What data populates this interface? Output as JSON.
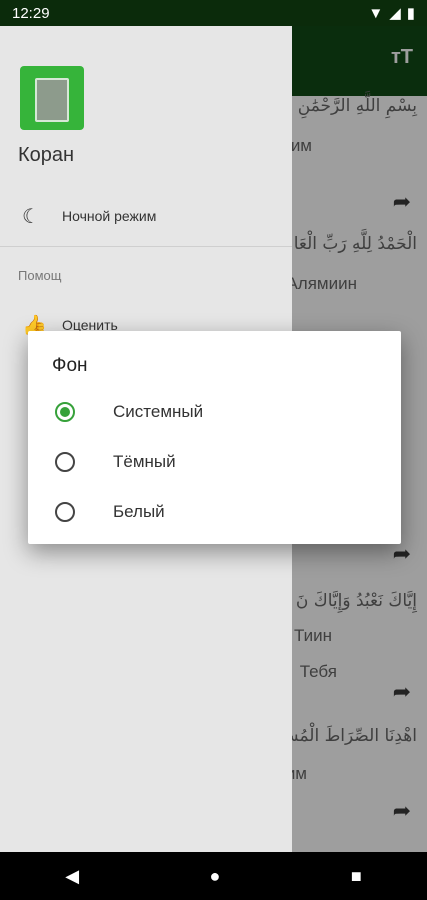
{
  "status_bar": {
    "time": "12:29"
  },
  "content": {
    "lines": [
      {
        "text": "بِسْمِ اللَّهِ الرَّحْمَٰنِ",
        "arabic": true
      },
      {
        "text": "им",
        "arabic": false
      },
      {
        "text": "الْحَمْدُ لِلَّهِ رَبِّ الْعَا",
        "arabic": true
      },
      {
        "text": "Алямиин",
        "arabic": false
      },
      {
        "text": "إِيَّاكَ نَعْبُدُ وَإِيَّاكَ نَ",
        "arabic": true
      },
      {
        "text": "Тиин",
        "arabic": false
      },
      {
        "text": "Тебя",
        "arabic": false
      },
      {
        "text": "اهْدِنَا الصِّرَاطَ الْمُسْ",
        "arabic": true
      },
      {
        "text": "им",
        "arabic": false
      }
    ]
  },
  "drawer": {
    "app_name": "Коран",
    "items": [
      {
        "label": "Ночной режим",
        "icon": "moon-icon"
      },
      {
        "label": "Оценить",
        "icon": "thumb-up-icon"
      }
    ],
    "section_label": "Помощ"
  },
  "dialog": {
    "title": "Фон",
    "options": [
      {
        "label": "Системный",
        "selected": true
      },
      {
        "label": "Тёмный",
        "selected": false
      },
      {
        "label": "Белый",
        "selected": false
      }
    ]
  },
  "colors": {
    "app_bar": "#114a15",
    "accent": "#36a13a",
    "status_bar": "#0b2b0b"
  }
}
